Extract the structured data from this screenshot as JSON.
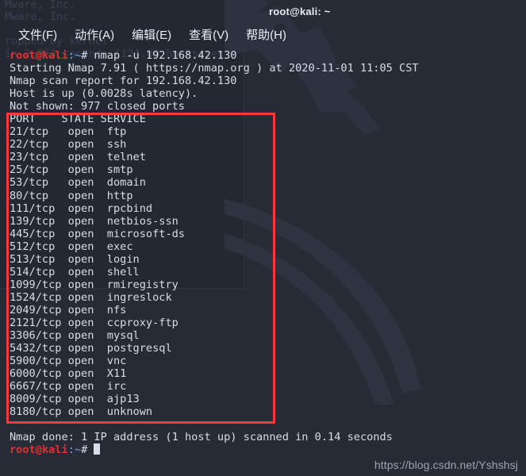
{
  "window": {
    "title": "root@kali: ~",
    "menu": [
      {
        "label": "文件(F)",
        "name": "menu-file"
      },
      {
        "label": "动作(A)",
        "name": "menu-actions"
      },
      {
        "label": "编辑(E)",
        "name": "menu-edit"
      },
      {
        "label": "查看(V)",
        "name": "menu-view"
      },
      {
        "label": "帮助(H)",
        "name": "menu-help"
      }
    ]
  },
  "background_window": {
    "lines": [
      "Mware, Inc.",
      "Mware, Inc.",
      "ropped by kernel",
      "in 2.063 seconds (124.00 hosts/sec"
    ]
  },
  "prompt": {
    "user": "root",
    "at": "@",
    "host": "kali",
    "colon": ":",
    "path": "~",
    "sigil": "#"
  },
  "terminal": {
    "command": " nmap -u 192.168.42.130",
    "header_lines": [
      "Starting Nmap 7.91 ( https://nmap.org ) at 2020-11-01 11:05 CST",
      "Nmap scan report for 192.168.42.130",
      "Host is up (0.0028s latency).",
      "Not shown: 977 closed ports"
    ],
    "table_header": {
      "port": "PORT",
      "state": "STATE",
      "service": "SERVICE"
    },
    "rows": [
      {
        "port": "21/tcp",
        "state": "open",
        "service": "ftp"
      },
      {
        "port": "22/tcp",
        "state": "open",
        "service": "ssh"
      },
      {
        "port": "23/tcp",
        "state": "open",
        "service": "telnet"
      },
      {
        "port": "25/tcp",
        "state": "open",
        "service": "smtp"
      },
      {
        "port": "53/tcp",
        "state": "open",
        "service": "domain"
      },
      {
        "port": "80/tcp",
        "state": "open",
        "service": "http"
      },
      {
        "port": "111/tcp",
        "state": "open",
        "service": "rpcbind"
      },
      {
        "port": "139/tcp",
        "state": "open",
        "service": "netbios-ssn"
      },
      {
        "port": "445/tcp",
        "state": "open",
        "service": "microsoft-ds"
      },
      {
        "port": "512/tcp",
        "state": "open",
        "service": "exec"
      },
      {
        "port": "513/tcp",
        "state": "open",
        "service": "login"
      },
      {
        "port": "514/tcp",
        "state": "open",
        "service": "shell"
      },
      {
        "port": "1099/tcp",
        "state": "open",
        "service": "rmiregistry"
      },
      {
        "port": "1524/tcp",
        "state": "open",
        "service": "ingreslock"
      },
      {
        "port": "2049/tcp",
        "state": "open",
        "service": "nfs"
      },
      {
        "port": "2121/tcp",
        "state": "open",
        "service": "ccproxy-ftp"
      },
      {
        "port": "3306/tcp",
        "state": "open",
        "service": "mysql"
      },
      {
        "port": "5432/tcp",
        "state": "open",
        "service": "postgresql"
      },
      {
        "port": "5900/tcp",
        "state": "open",
        "service": "vnc"
      },
      {
        "port": "6000/tcp",
        "state": "open",
        "service": "X11"
      },
      {
        "port": "6667/tcp",
        "state": "open",
        "service": "irc"
      },
      {
        "port": "8009/tcp",
        "state": "open",
        "service": "ajp13"
      },
      {
        "port": "8180/tcp",
        "state": "open",
        "service": "unknown"
      }
    ],
    "footer_line": "Nmap done: 1 IP address (1 host up) scanned in 0.14 seconds"
  },
  "annotation": {
    "color": "#f73b33"
  },
  "watermark": {
    "text": "https://blog.csdn.net/Yshshsj"
  }
}
